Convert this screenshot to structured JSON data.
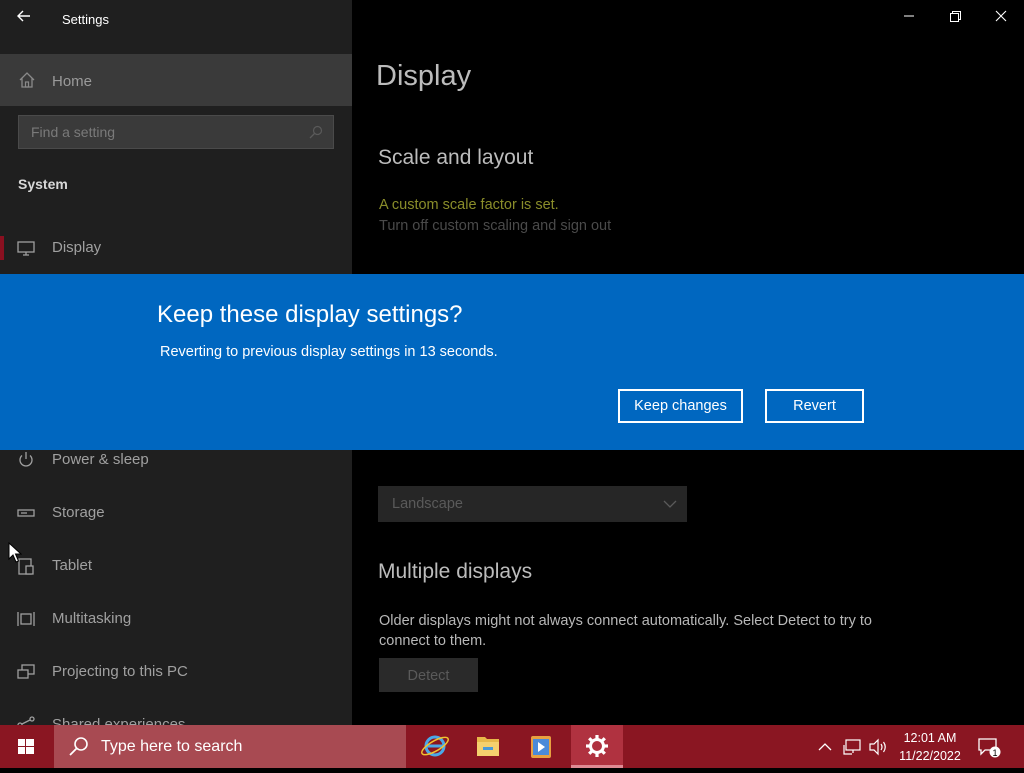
{
  "window": {
    "title": "Settings",
    "controls": {
      "minimize": "minimize",
      "maximize": "restore",
      "close": "close"
    }
  },
  "sidebar": {
    "home_label": "Home",
    "search_placeholder": "Find a setting",
    "section": "System",
    "items": [
      {
        "label": "Display",
        "icon": "monitor-icon",
        "active": true
      },
      {
        "label": "Power & sleep",
        "icon": "power-icon"
      },
      {
        "label": "Storage",
        "icon": "storage-icon"
      },
      {
        "label": "Tablet",
        "icon": "tablet-icon"
      },
      {
        "label": "Multitasking",
        "icon": "multitasking-icon"
      },
      {
        "label": "Projecting to this PC",
        "icon": "projecting-icon"
      },
      {
        "label": "Shared experiences",
        "icon": "shared-icon"
      }
    ]
  },
  "main": {
    "title": "Display",
    "scale_heading": "Scale and layout",
    "scale_warning": "A custom scale factor is set.",
    "scale_link": "Turn off custom scaling and sign out",
    "orientation_value": "Landscape",
    "multiple_heading": "Multiple displays",
    "multiple_desc": "Older displays might not always connect automatically. Select Detect to try to connect to them.",
    "detect_label": "Detect"
  },
  "dialog": {
    "title": "Keep these display settings?",
    "message": "Reverting to previous display settings in 13 seconds.",
    "keep_label": "Keep changes",
    "revert_label": "Revert"
  },
  "taskbar": {
    "search_placeholder": "Type here to search",
    "apps": [
      "internet-explorer-icon",
      "file-explorer-icon",
      "media-player-icon",
      "settings-gear-icon"
    ],
    "time": "12:01 AM",
    "date": "11/22/2022",
    "notification_count": "1"
  },
  "colors": {
    "accent_blue": "#0067c0",
    "taskbar_red": "#8a1622",
    "warning_olive": "#8a8d2a"
  }
}
